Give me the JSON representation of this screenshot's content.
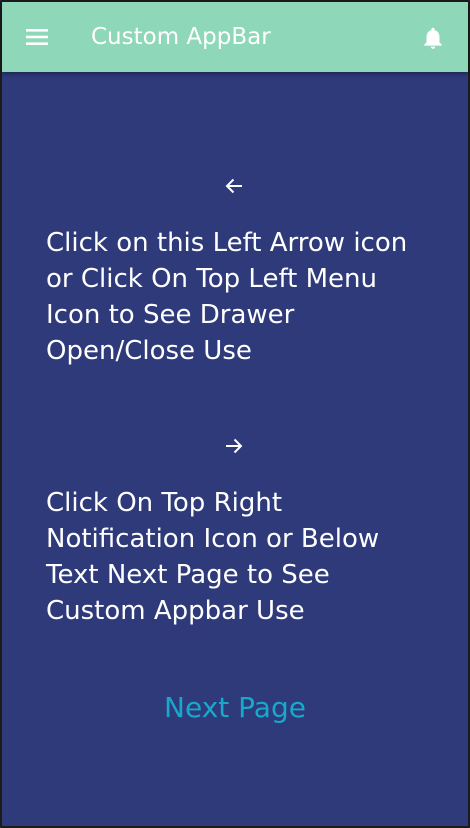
{
  "appbar": {
    "title": "Custom AppBar",
    "menu_icon": "menu-icon",
    "notification_icon": "bell-icon",
    "background": "#8ed7b8"
  },
  "main": {
    "background": "#2e3a7a",
    "left_arrow_icon": "arrow-left-icon",
    "left_text": "Click on this Left Arrow icon or Click On Top Left Menu Icon to See Drawer Open/Close Use",
    "right_arrow_icon": "arrow-right-icon",
    "right_text": "Click On Top Right Notification Icon or Below Text Next Page to See Custom Appbar Use",
    "next_page_label": "Next Page",
    "link_color": "#18a8c9"
  }
}
